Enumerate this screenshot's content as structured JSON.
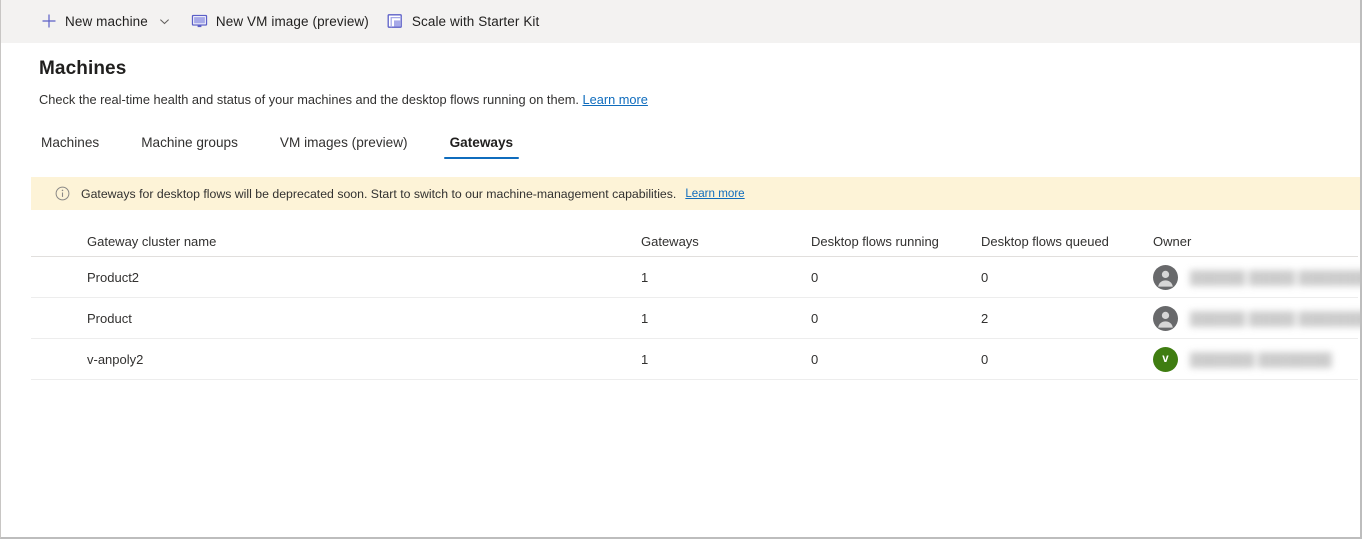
{
  "commandbar": {
    "items": [
      {
        "label": "New machine",
        "icon": "plus-icon",
        "has_chevron": true
      },
      {
        "label": "New VM image (preview)",
        "icon": "monitor-icon",
        "has_chevron": false
      },
      {
        "label": "Scale with Starter Kit",
        "icon": "scale-icon",
        "has_chevron": false
      }
    ]
  },
  "header": {
    "title": "Machines",
    "description": "Check the real-time health and status of your machines and the desktop flows running on them.",
    "learn_more": "Learn more"
  },
  "tabs": [
    {
      "label": "Machines",
      "active": false
    },
    {
      "label": "Machine groups",
      "active": false
    },
    {
      "label": "VM images (preview)",
      "active": false
    },
    {
      "label": "Gateways",
      "active": true
    }
  ],
  "banner": {
    "icon": "info-circle-icon",
    "text": "Gateways for desktop flows will be deprecated soon. Start to switch to our machine-management capabilities.",
    "link": "Learn more",
    "background": "#fdf3d7"
  },
  "table": {
    "columns": [
      "Gateway cluster name",
      "Gateways",
      "Desktop flows running",
      "Desktop flows queued",
      "Owner"
    ],
    "rows": [
      {
        "name": "Product2",
        "gateways": "1",
        "running": "0",
        "queued": "0",
        "owner": {
          "avatar_type": "generic",
          "avatar_initial": "",
          "avatar_color": "#68696b",
          "name_redacted": "██████ █████ ███████████ ███"
        }
      },
      {
        "name": "Product",
        "gateways": "1",
        "running": "0",
        "queued": "2",
        "owner": {
          "avatar_type": "generic",
          "avatar_initial": "",
          "avatar_color": "#68696b",
          "name_redacted": "██████ █████ ███████████ ███"
        }
      },
      {
        "name": "v-anpoly2",
        "gateways": "1",
        "running": "0",
        "queued": "0",
        "owner": {
          "avatar_type": "initial",
          "avatar_initial": "v",
          "avatar_color": "#3f7d11",
          "name_redacted": "███████ ████████"
        }
      }
    ]
  },
  "colors": {
    "accent": "#0f6cbd",
    "commandbar_bg": "#f3f2f1",
    "banner_bg": "#fdf3d7",
    "text": "#323130"
  }
}
